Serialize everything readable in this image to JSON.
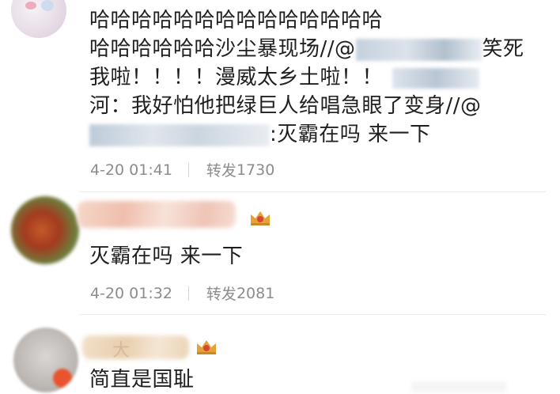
{
  "comments": [
    {
      "lines": [
        "哈哈哈哈哈哈哈哈哈哈哈哈哈哈",
        "哈哈哈哈哈哈沙尘暴现场//@",
        "我啦！！！！漫威太乡土啦！！",
        "河：我好怕他把绿巨人给唱急眼了变身//@",
        ":灭霸在吗 来一下"
      ],
      "extra": {
        "laugh": "笑死"
      },
      "time": "4-20 01:41",
      "repost_label": "转发",
      "repost_count": "1730"
    },
    {
      "text": "灭霸在吗 来一下",
      "time": "4-20 01:32",
      "repost_label": "转发",
      "repost_count": "2081"
    },
    {
      "name_fragment": "大",
      "text": "简直是国耻"
    }
  ],
  "colors": {
    "text": "#1f1f1f",
    "meta": "#8c8c8c",
    "crown_gold": "#e2a33a",
    "crown_red": "#d9452e"
  }
}
